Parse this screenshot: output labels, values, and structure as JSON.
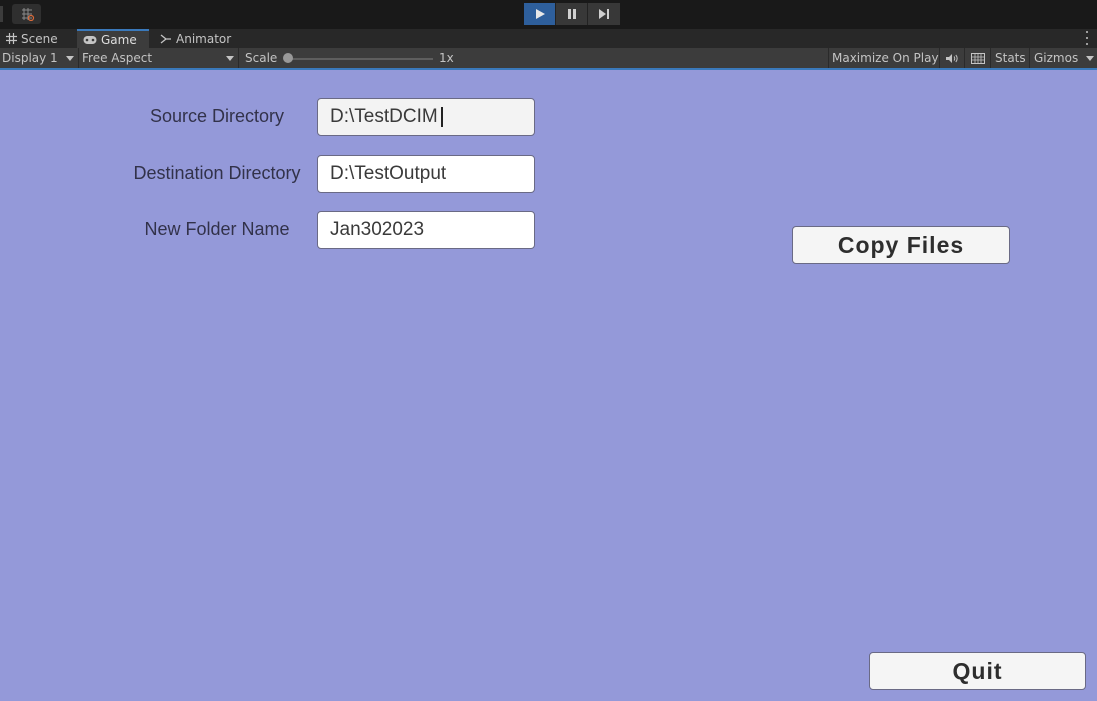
{
  "toolbar": {
    "play_button": "play",
    "pause_button": "pause",
    "step_button": "step"
  },
  "tabs": [
    {
      "label": "Scene",
      "icon": "grid-icon"
    },
    {
      "label": "Game",
      "icon": "gamepad-icon",
      "active": true
    },
    {
      "label": "Animator",
      "icon": "animator-icon"
    }
  ],
  "game_toolbar": {
    "display": "Display 1",
    "aspect": "Free Aspect",
    "scale_label": "Scale",
    "scale_value": "1x",
    "scale_level": 0,
    "maximize": "Maximize On Play",
    "stats": "Stats",
    "gizmos": "Gizmos"
  },
  "form": {
    "source_label": "Source Directory",
    "source_value": "D:\\TestDCIM",
    "destination_label": "Destination Directory",
    "destination_value": "D:\\TestOutput",
    "folder_label": "New Folder Name",
    "folder_value": "Jan302023"
  },
  "actions": {
    "copy_label": "Copy Files",
    "quit_label": "Quit"
  },
  "colors": {
    "viewport_bg": "#9499d9",
    "accent": "#3a79bb",
    "play_active": "#2e5f9c"
  }
}
